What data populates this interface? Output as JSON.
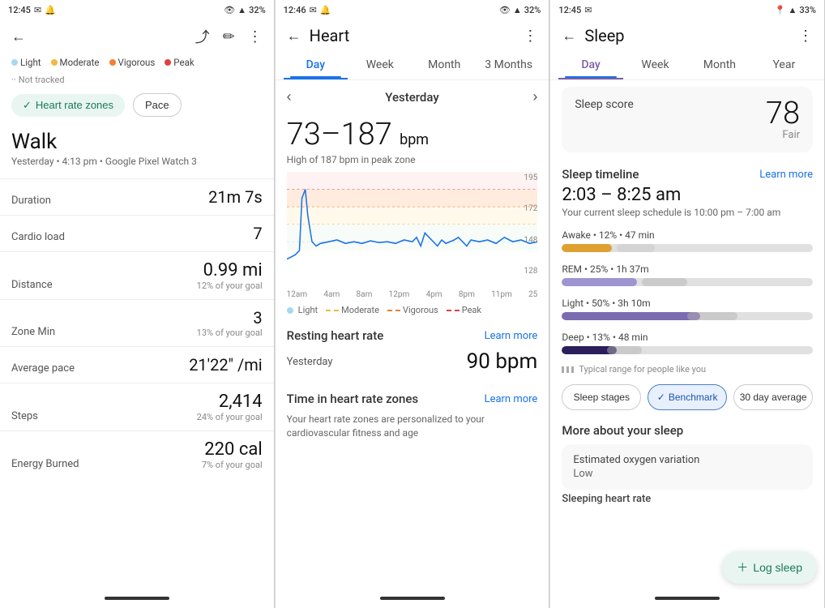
{
  "panel1": {
    "status": {
      "time": "12:45",
      "battery": "32%"
    },
    "legend": [
      {
        "label": "Light",
        "color": "#a8d8f0"
      },
      {
        "label": "Moderate",
        "color": "#f0b840"
      },
      {
        "label": "Vigorous",
        "color": "#f08030"
      },
      {
        "label": "Peak",
        "color": "#e04040"
      },
      {
        "label": "Not tracked",
        "color": "#aaa"
      }
    ],
    "zone_btn": "Heart rate zones",
    "pace_btn": "Pace",
    "activity": "Walk",
    "subtitle": "Yesterday • 4:13 pm • Google Pixel Watch 3",
    "metrics": [
      {
        "label": "Duration",
        "value": "21m 7s",
        "sub": ""
      },
      {
        "label": "Cardio load",
        "value": "7",
        "sub": ""
      },
      {
        "label": "Distance",
        "value": "0.99 mi",
        "sub": "12% of your goal"
      },
      {
        "label": "Zone Min",
        "value": "3",
        "sub": "13% of your goal"
      },
      {
        "label": "Average pace",
        "value": "21'22\" /mi",
        "sub": ""
      },
      {
        "label": "Steps",
        "value": "2,414",
        "sub": "24% of your goal"
      },
      {
        "label": "Energy Burned",
        "value": "220 cal",
        "sub": "7% of your goal"
      }
    ]
  },
  "panel2": {
    "status": {
      "time": "12:46",
      "battery": "32%"
    },
    "title": "Heart",
    "tabs": [
      "Day",
      "Week",
      "Month",
      "3 Months"
    ],
    "active_tab": 0,
    "date": "Yesterday",
    "heart_range": "73–187",
    "heart_unit": "bpm",
    "heart_high": "High of 187 bpm in peak zone",
    "chart_x_labels": [
      "12am",
      "4am",
      "8am",
      "12pm",
      "4pm",
      "8pm",
      "11pm"
    ],
    "chart_y_labels": [
      "195",
      "172",
      "148",
      "128",
      "25"
    ],
    "chart_legend": [
      {
        "label": "Light",
        "color": "#a8d8f0",
        "style": "dot"
      },
      {
        "label": "Moderate",
        "color": "#f0b840",
        "style": "dashed"
      },
      {
        "label": "Vigorous",
        "color": "#f08030",
        "style": "dashed"
      },
      {
        "label": "Peak",
        "color": "#e04040",
        "style": "dashed"
      }
    ],
    "resting_title": "Resting heart rate",
    "resting_learn": "Learn more",
    "resting_label": "Yesterday",
    "resting_value": "90 bpm",
    "zone_title": "Time in heart rate zones",
    "zone_learn": "Learn more",
    "zone_info": "Your heart rate zones are personalized to your cardiovascular fitness and age"
  },
  "panel3": {
    "status": {
      "time": "12:45",
      "battery": "33%"
    },
    "title": "Sleep",
    "tabs": [
      "Day",
      "Week",
      "Month",
      "Year"
    ],
    "active_tab": 0,
    "sleep_score_label": "Sleep score",
    "sleep_score_value": "78",
    "sleep_score_sub": "Fair",
    "timeline_title": "Sleep timeline",
    "timeline_learn": "Learn more",
    "sleep_time": "2:03 – 8:25 am",
    "sleep_schedule": "Your current sleep schedule is 10:00 pm – 7:00 am",
    "stages": [
      {
        "label": "Awake • 12% • 47 min",
        "fill_pct": 20,
        "fill_color": "#e0a030",
        "benchmark_start": 22,
        "benchmark_width": 15
      },
      {
        "label": "REM • 25% • 1h 37m",
        "fill_pct": 30,
        "fill_color": "#9e94d0",
        "benchmark_start": 32,
        "benchmark_width": 18
      },
      {
        "label": "Light • 50% • 3h 10m",
        "fill_pct": 55,
        "fill_color": "#7b6bb0",
        "benchmark_start": 50,
        "benchmark_width": 20
      },
      {
        "label": "Deep • 13% • 48 min",
        "fill_pct": 22,
        "fill_color": "#2a1f5a",
        "benchmark_start": 18,
        "benchmark_width": 14
      }
    ],
    "typical_label": "Typical range for people like you",
    "view_btns": [
      "Sleep stages",
      "Benchmark",
      "30 day average"
    ],
    "active_view": 1,
    "more_title": "More about your sleep",
    "oxy_title": "Estimated oxygen variation",
    "oxy_value": "Low",
    "sleeping_hr_title": "Sleeping heart rate",
    "log_sleep": "Log sleep"
  }
}
